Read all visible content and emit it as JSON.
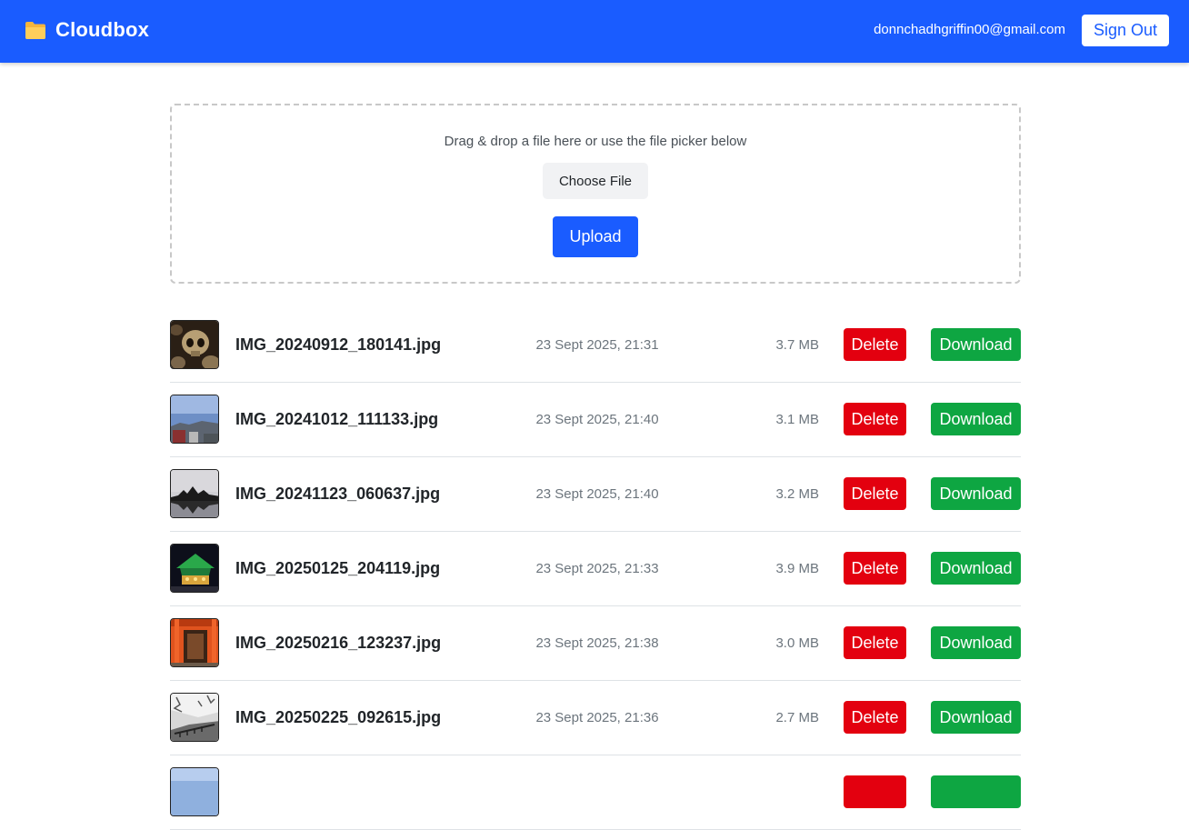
{
  "header": {
    "brand": "Cloudbox",
    "brand_icon": "folder-icon",
    "user_email": "donnchadhgriffin00@gmail.com",
    "sign_out_label": "Sign Out",
    "colors": {
      "primary": "#1a5cff"
    }
  },
  "upload": {
    "hint": "Drag & drop a file here or use the file picker below",
    "choose_label": "Choose File",
    "upload_label": "Upload"
  },
  "files": [
    {
      "name": "IMG_20240912_180141.jpg",
      "date": "23 Sept 2025, 21:31",
      "size": "3.7 MB",
      "delete_label": "Delete",
      "download_label": "Download",
      "thumb": "skulls"
    },
    {
      "name": "IMG_20241012_111133.jpg",
      "date": "23 Sept 2025, 21:40",
      "size": "3.1 MB",
      "delete_label": "Delete",
      "download_label": "Download",
      "thumb": "sky-city"
    },
    {
      "name": "IMG_20241123_060637.jpg",
      "date": "23 Sept 2025, 21:40",
      "size": "3.2 MB",
      "delete_label": "Delete",
      "download_label": "Download",
      "thumb": "temple-reflection"
    },
    {
      "name": "IMG_20250125_204119.jpg",
      "date": "23 Sept 2025, 21:33",
      "size": "3.9 MB",
      "delete_label": "Delete",
      "download_label": "Download",
      "thumb": "lit-pagoda"
    },
    {
      "name": "IMG_20250216_123237.jpg",
      "date": "23 Sept 2025, 21:38",
      "size": "3.0 MB",
      "delete_label": "Delete",
      "download_label": "Download",
      "thumb": "torii-gates"
    },
    {
      "name": "IMG_20250225_092615.jpg",
      "date": "23 Sept 2025, 21:36",
      "size": "2.7 MB",
      "delete_label": "Delete",
      "download_label": "Download",
      "thumb": "bw-trees"
    },
    {
      "name": "",
      "date": "",
      "size": "",
      "delete_label": "",
      "download_label": "",
      "thumb": "sky-partial"
    }
  ],
  "colors": {
    "delete": "#e3000f",
    "download": "#0ea642"
  }
}
